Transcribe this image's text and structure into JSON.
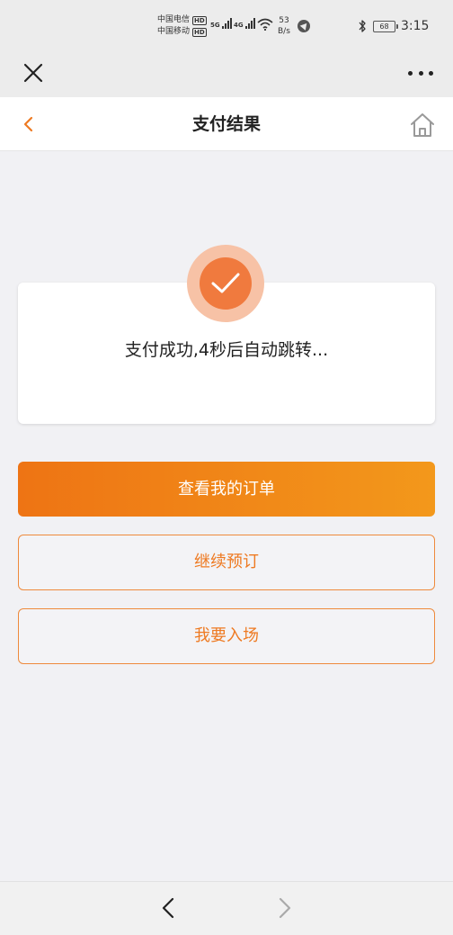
{
  "status_bar": {
    "carrier_1": "中国电信",
    "carrier_2": "中国移动",
    "hd_badge": "HD",
    "sim1_tech": "5G",
    "sim2_tech": "4G",
    "net_speed_value": "53",
    "net_speed_unit": "B/s",
    "battery": "68",
    "time": "3:15"
  },
  "top_bar": {
    "close_icon": "close-icon",
    "more_icon": "more-icon"
  },
  "header": {
    "title": "支付结果",
    "back_icon": "chevron-left-icon",
    "home_icon": "home-icon"
  },
  "result": {
    "message": "支付成功,4秒后自动跳转...",
    "icon": "check-icon"
  },
  "buttons": {
    "view_orders": "查看我的订单",
    "continue_booking": "继续预订",
    "enter_venue": "我要入场"
  },
  "bottom_nav": {
    "back_icon": "arrow-back-icon",
    "forward_icon": "arrow-forward-icon"
  },
  "colors": {
    "accent": "#f07a3e",
    "button_gradient_start": "#ee7414",
    "button_gradient_end": "#f3981b",
    "outline": "#ee8a3c"
  }
}
